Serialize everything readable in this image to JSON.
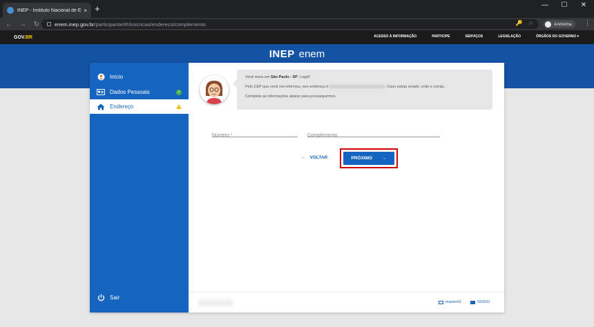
{
  "browser": {
    "tab_title": "INEP - Instituto Nacional de Estu",
    "tab_close": "×",
    "new_tab": "+",
    "window_controls": [
      "—",
      "☐",
      "✕"
    ],
    "nav": {
      "back": "←",
      "forward": "→",
      "reload": "↻"
    },
    "url_host": "enem.inep.gov.br",
    "url_path": "/participante/#!/inscricao/endereco/complemento",
    "omni_icons": [
      "🔑",
      "☆"
    ],
    "profile_name": "Anônima",
    "menu": "⋮"
  },
  "govbar": {
    "logo_gov": "GOV",
    "logo_br": ".BR",
    "links": [
      "ACESSO À INFORMAÇÃO",
      "PARTICIPE",
      "SERVIÇOS",
      "LEGISLAÇÃO",
      "ÓRGÃOS DO GOVERNO ▾"
    ]
  },
  "brand": {
    "inep": "INEP",
    "enem": "enem"
  },
  "sidebar": {
    "items": [
      {
        "label": "Início",
        "icon": "user-circle-icon",
        "status": ""
      },
      {
        "label": "Dados Pessoais",
        "icon": "id-card-icon",
        "status": "check"
      },
      {
        "label": "Endereço",
        "icon": "home-icon",
        "status": "warning"
      }
    ],
    "exit_label": "Sair"
  },
  "assistant": {
    "line1_pre": "Você mora em ",
    "line1_bold": "São Paulo - SP",
    "line1_post": ". Legal!",
    "line2_pre": "Pelo CEP que você me informou, seu endereço é ",
    "line2_post": ". Caso esteja errado, volte e corrija.",
    "line3": "Complete as informações abaixo para prosseguirmos."
  },
  "form": {
    "numero_placeholder": "Número *",
    "complemento_placeholder": "Complemento"
  },
  "buttons": {
    "back_arrow": "←",
    "back_label": "VOLTAR",
    "next_label": "PRÓXIMO",
    "next_arrow": "→"
  },
  "footer": {
    "item1": "master01",
    "item2": "S02011"
  },
  "colors": {
    "primary": "#1565c0",
    "header_band": "#1452a3",
    "highlight": "#cc0000"
  }
}
